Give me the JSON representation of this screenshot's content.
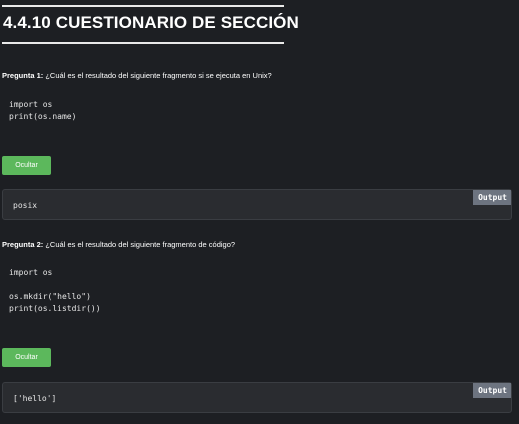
{
  "section": {
    "title": "4.4.10 CUESTIONARIO DE SECCIÓN"
  },
  "questions": [
    {
      "label": "Pregunta 1:",
      "text": " ¿Cuál es el resultado del siguiente fragmento si se ejecuta en Unix?",
      "code": "import os\nprint(os.name)",
      "button": "Ocultar",
      "output_tag": "Output",
      "output": "posix"
    },
    {
      "label": "Pregunta 2:",
      "text": " ¿Cuál es el resultado del siguiente fragmento de código?",
      "code": "import os\n\nos.mkdir(\"hello\")\nprint(os.listdir())",
      "button": "Ocultar",
      "output_tag": "Output",
      "output": "['hello']"
    }
  ]
}
